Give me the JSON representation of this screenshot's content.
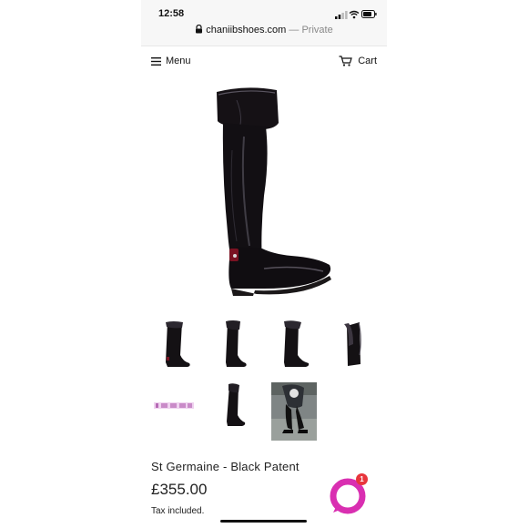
{
  "status_bar": {
    "time": "12:58",
    "icons": [
      "cellular-signal-icon",
      "wifi-icon",
      "battery-icon"
    ]
  },
  "address_bar": {
    "domain": "chaniibshoes.com",
    "mode": " — Private"
  },
  "nav": {
    "menu_label": "Menu",
    "cart_label": "Cart"
  },
  "product": {
    "title": "St Germaine - Black Patent",
    "price": "£355.00",
    "tax_note": "Tax included."
  },
  "gallery": {
    "thumbnail_count": 7,
    "hero_alt": "boot-main-photo"
  },
  "chat_widget": {
    "badge_count": "1",
    "accent_color": "#d92fb1"
  },
  "colors": {
    "statusbar_bg": "#f7f7f7",
    "badge_red": "#e8353c",
    "text": "#222222"
  }
}
